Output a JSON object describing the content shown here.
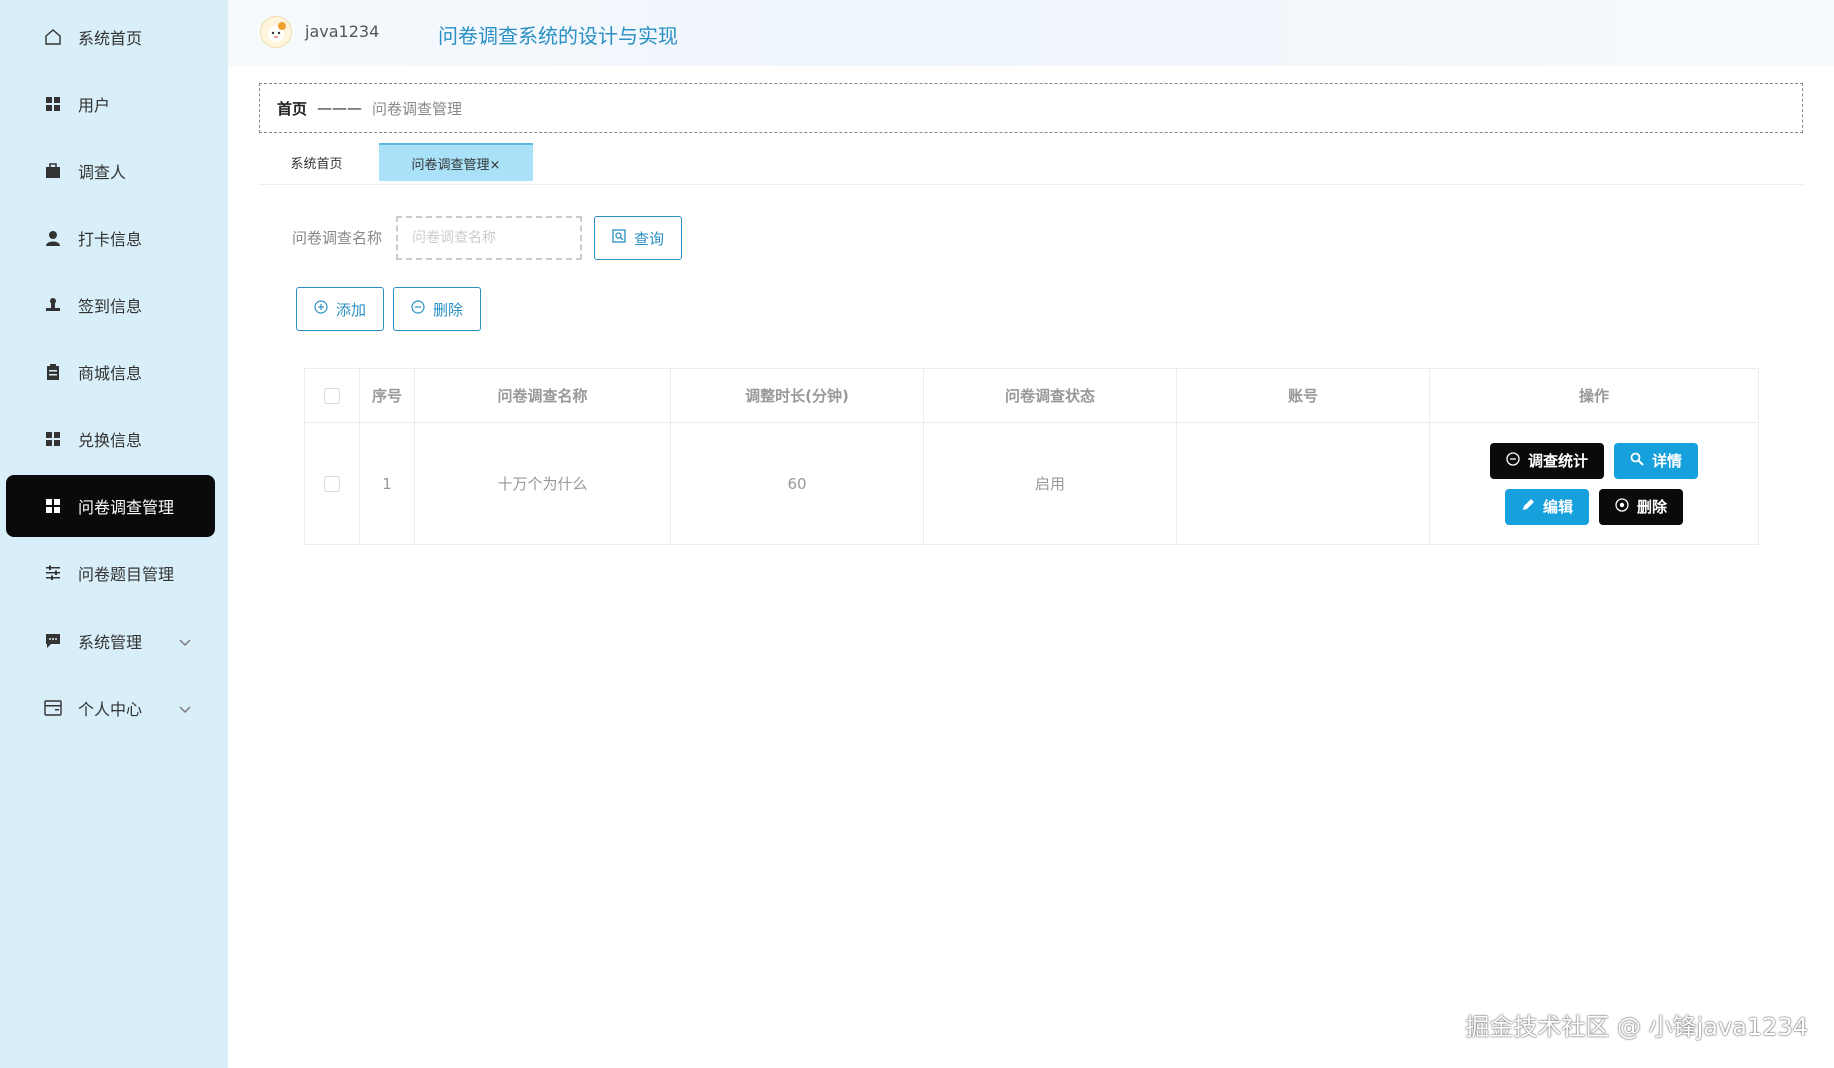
{
  "sidebar": {
    "items": [
      {
        "label": "系统首页",
        "icon": "home-icon"
      },
      {
        "label": "用户",
        "icon": "grid-icon"
      },
      {
        "label": "调查人",
        "icon": "briefcase-icon"
      },
      {
        "label": "打卡信息",
        "icon": "user-icon"
      },
      {
        "label": "签到信息",
        "icon": "stamp-icon"
      },
      {
        "label": "商城信息",
        "icon": "clipboard-icon"
      },
      {
        "label": "兑换信息",
        "icon": "grid-icon"
      },
      {
        "label": "问卷调查管理",
        "icon": "grid-icon"
      },
      {
        "label": "问卷题目管理",
        "icon": "sliders-icon"
      },
      {
        "label": "系统管理",
        "icon": "chat-icon"
      },
      {
        "label": "个人中心",
        "icon": "card-icon"
      }
    ],
    "active_index": 7
  },
  "header": {
    "username": "java1234",
    "title": "问卷调查系统的设计与实现"
  },
  "breadcrumb": {
    "home": "首页",
    "separator": "———",
    "current": "问卷调查管理"
  },
  "tabs": [
    {
      "label": "系统首页"
    },
    {
      "label": "问卷调查管理×"
    }
  ],
  "search": {
    "label": "问卷调查名称",
    "placeholder": "问卷调查名称",
    "query_button": "查询"
  },
  "actions": {
    "add": "添加",
    "delete": "删除"
  },
  "table": {
    "headers": [
      "序号",
      "问卷调查名称",
      "调整时长(分钟)",
      "问卷调查状态",
      "账号",
      "操作"
    ],
    "rows": [
      {
        "index": "1",
        "name": "十万个为什么",
        "duration": "60",
        "status": "启用",
        "account": ""
      }
    ],
    "row_buttons": {
      "stats": "调查统计",
      "detail": "详情",
      "edit": "编辑",
      "delete": "删除"
    }
  },
  "watermark": "掘金技术社区 @ 小锋java1234",
  "colors": {
    "sidebar_bg": "#d8eef8",
    "active_bg": "#0a0a0a",
    "accent": "#2a8fc4",
    "tab_active": "#a9e1f8",
    "button_blue": "#16a0dc"
  }
}
